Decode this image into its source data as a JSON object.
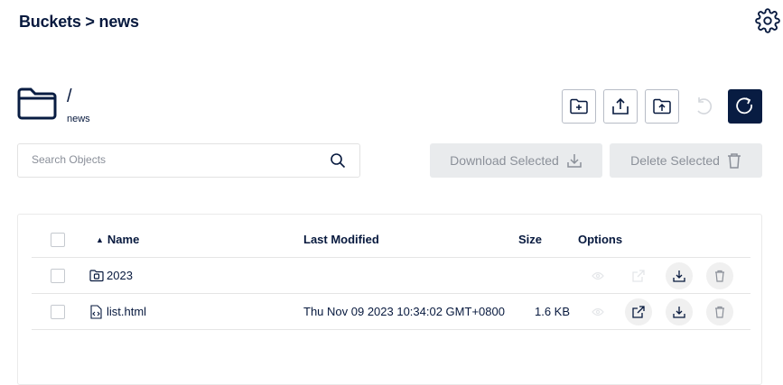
{
  "header": {
    "breadcrumb": "Buckets > news",
    "settings_icon": "gear-icon"
  },
  "path": {
    "current": "/",
    "bucket": "news"
  },
  "toolbar": {
    "buttons": [
      {
        "name": "new-folder-button",
        "icon": "folder-plus-icon",
        "state": "enabled"
      },
      {
        "name": "upload-file-button",
        "icon": "upload-icon",
        "state": "enabled"
      },
      {
        "name": "upload-folder-button",
        "icon": "folder-upload-icon",
        "state": "enabled"
      },
      {
        "name": "rewind-button",
        "icon": "rewind-icon",
        "state": "disabled"
      },
      {
        "name": "refresh-button",
        "icon": "refresh-icon",
        "state": "primary"
      }
    ]
  },
  "search": {
    "placeholder": "Search Objects",
    "value": ""
  },
  "actions": {
    "download_label": "Download Selected",
    "delete_label": "Delete Selected"
  },
  "table": {
    "columns": {
      "name": "Name",
      "last_modified": "Last Modified",
      "size": "Size",
      "options": "Options"
    },
    "sort_indicator": "▲",
    "rows": [
      {
        "type": "folder",
        "name": "2023",
        "last_modified": "",
        "size": "",
        "share_enabled": false
      },
      {
        "type": "file",
        "name": "list.html",
        "last_modified": "Thu Nov 09 2023 10:34:02 GMT+0800",
        "size": "1.6 KB",
        "share_enabled": true
      }
    ]
  },
  "colors": {
    "primary": "#081c42",
    "muted_button_bg": "#e9ebed",
    "muted_text": "#8b9099",
    "border": "#b7bcc6"
  }
}
